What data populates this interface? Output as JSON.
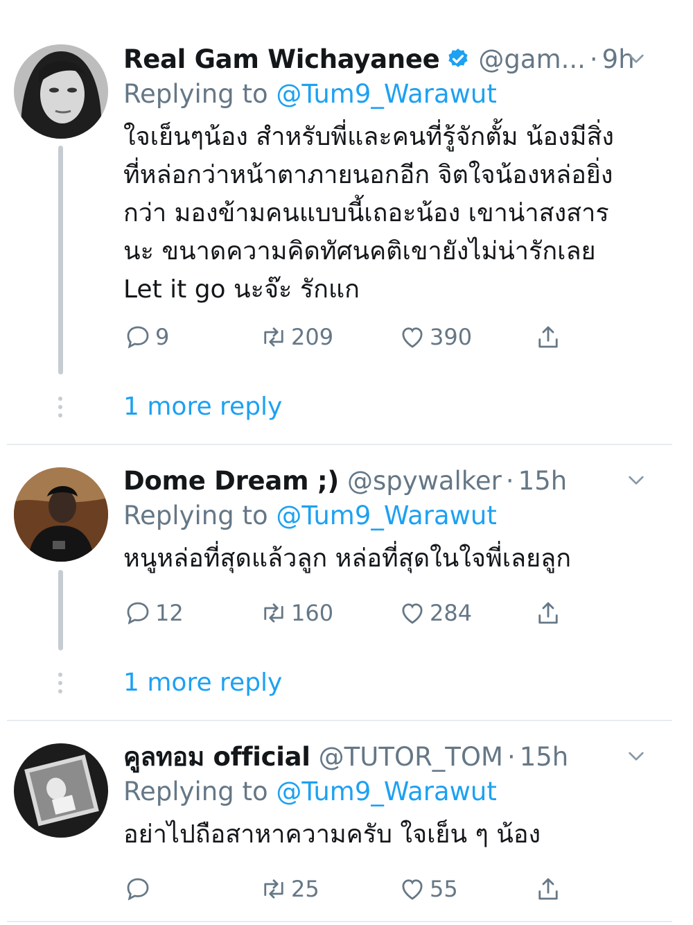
{
  "tweets": [
    {
      "display_name": "Real Gam Wichayanee",
      "verified": true,
      "handle": "@gam...",
      "time": "9h",
      "replying_label": "Replying to",
      "replying_to": "@Tum9_Warawut",
      "text_lines": [
        "ใจเย็นๆน้อง สำหรับพี่และคนที่รู้จักตั้ม น้องมีสิ่ง",
        "ที่หล่อกว่าหน้าตาภายนอกอีก จิตใจน้องหล่อยิ่ง",
        "กว่า มองข้ามคนแบบนี้เถอะน้อง เขาน่าสงสาร",
        "นะ ขนาดความคิดทัศนคติเขายังไม่น่ารักเลย",
        "Let it go นะจ๊ะ รักแก"
      ],
      "replies": "9",
      "retweets": "209",
      "likes": "390",
      "more_reply": "1 more reply"
    },
    {
      "display_name": "Dome Dream ;)",
      "verified": false,
      "handle": "@spywalker",
      "time": "15h",
      "replying_label": "Replying to",
      "replying_to": "@Tum9_Warawut",
      "text_lines": [
        "หนูหล่อที่สุดแล้วลูก หล่อที่สุดในใจพี่เลยลูก"
      ],
      "replies": "12",
      "retweets": "160",
      "likes": "284",
      "more_reply": "1 more reply"
    },
    {
      "display_name": "คูลทอม official",
      "verified": false,
      "handle": "@TUTOR_TOM",
      "time": "15h",
      "replying_label": "Replying to",
      "replying_to": "@Tum9_Warawut",
      "text_lines": [
        "อย่าไปถือสาหาความครับ ใจเย็น ๆ น้อง"
      ],
      "replies": "",
      "retweets": "25",
      "likes": "55"
    }
  ],
  "colors": {
    "link": "#1da1f2",
    "muted": "#657786",
    "text": "#14171a",
    "thread_line": "#c6ccd2"
  },
  "icons": [
    "verified-badge-icon",
    "chevron-down-icon",
    "reply-icon",
    "retweet-icon",
    "like-icon",
    "share-icon",
    "more-dots-icon"
  ]
}
